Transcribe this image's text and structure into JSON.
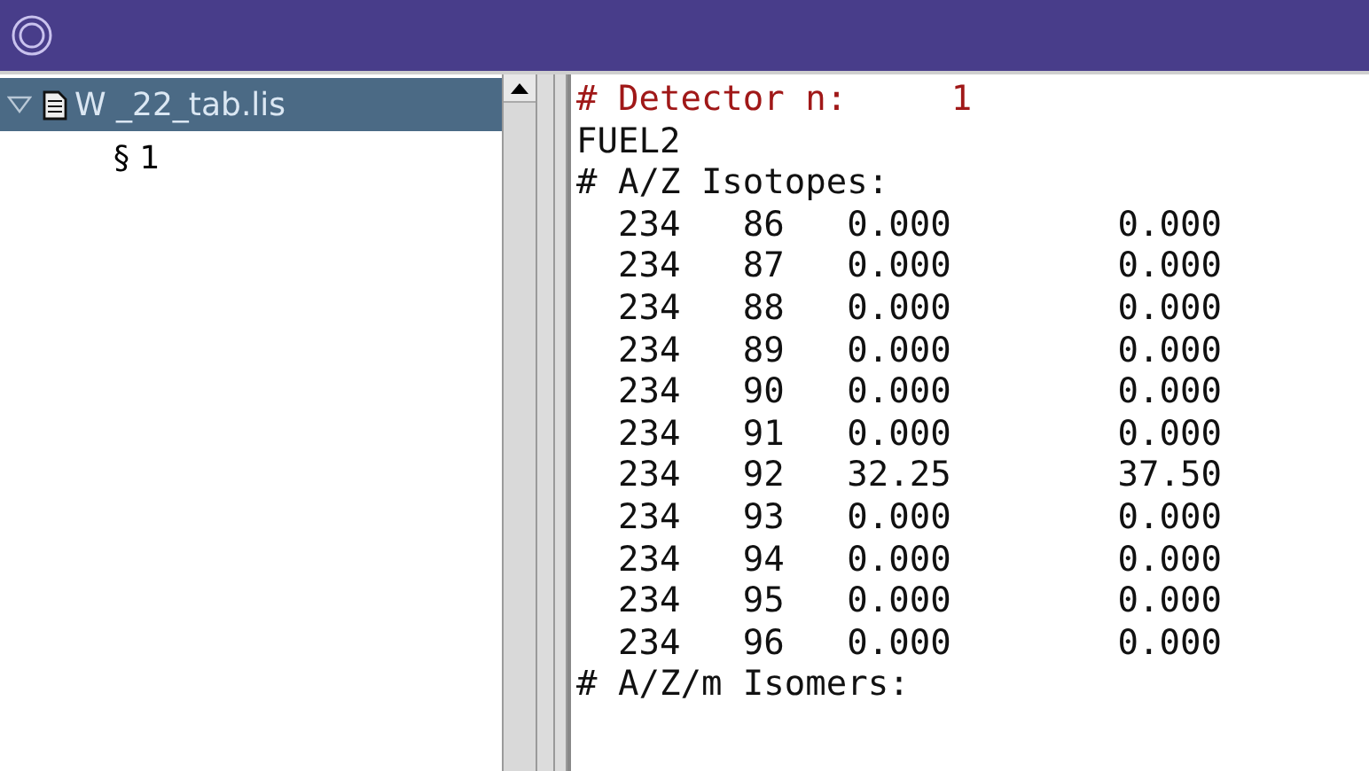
{
  "tree": {
    "items": [
      {
        "label": "W _22_tab.lis",
        "expanded": true,
        "selected": true,
        "children": [
          {
            "label": "§ 1",
            "selected": false
          }
        ]
      }
    ]
  },
  "editor": {
    "lines": [
      {
        "kind": "comment",
        "text": "# Detector n:     1"
      },
      {
        "kind": "text",
        "text": "FUEL2"
      },
      {
        "kind": "text",
        "text": "# A/Z Isotopes:"
      },
      {
        "kind": "text",
        "text": "  234   86   0.000        0.000"
      },
      {
        "kind": "text",
        "text": "  234   87   0.000        0.000"
      },
      {
        "kind": "text",
        "text": "  234   88   0.000        0.000"
      },
      {
        "kind": "text",
        "text": "  234   89   0.000        0.000"
      },
      {
        "kind": "text",
        "text": "  234   90   0.000        0.000"
      },
      {
        "kind": "text",
        "text": "  234   91   0.000        0.000"
      },
      {
        "kind": "text",
        "text": "  234   92   32.25        37.50"
      },
      {
        "kind": "text",
        "text": "  234   93   0.000        0.000"
      },
      {
        "kind": "text",
        "text": "  234   94   0.000        0.000"
      },
      {
        "kind": "text",
        "text": "  234   95   0.000        0.000"
      },
      {
        "kind": "text",
        "text": "  234   96   0.000        0.000"
      },
      {
        "kind": "text",
        "text": "# A/Z/m Isomers:"
      }
    ]
  }
}
